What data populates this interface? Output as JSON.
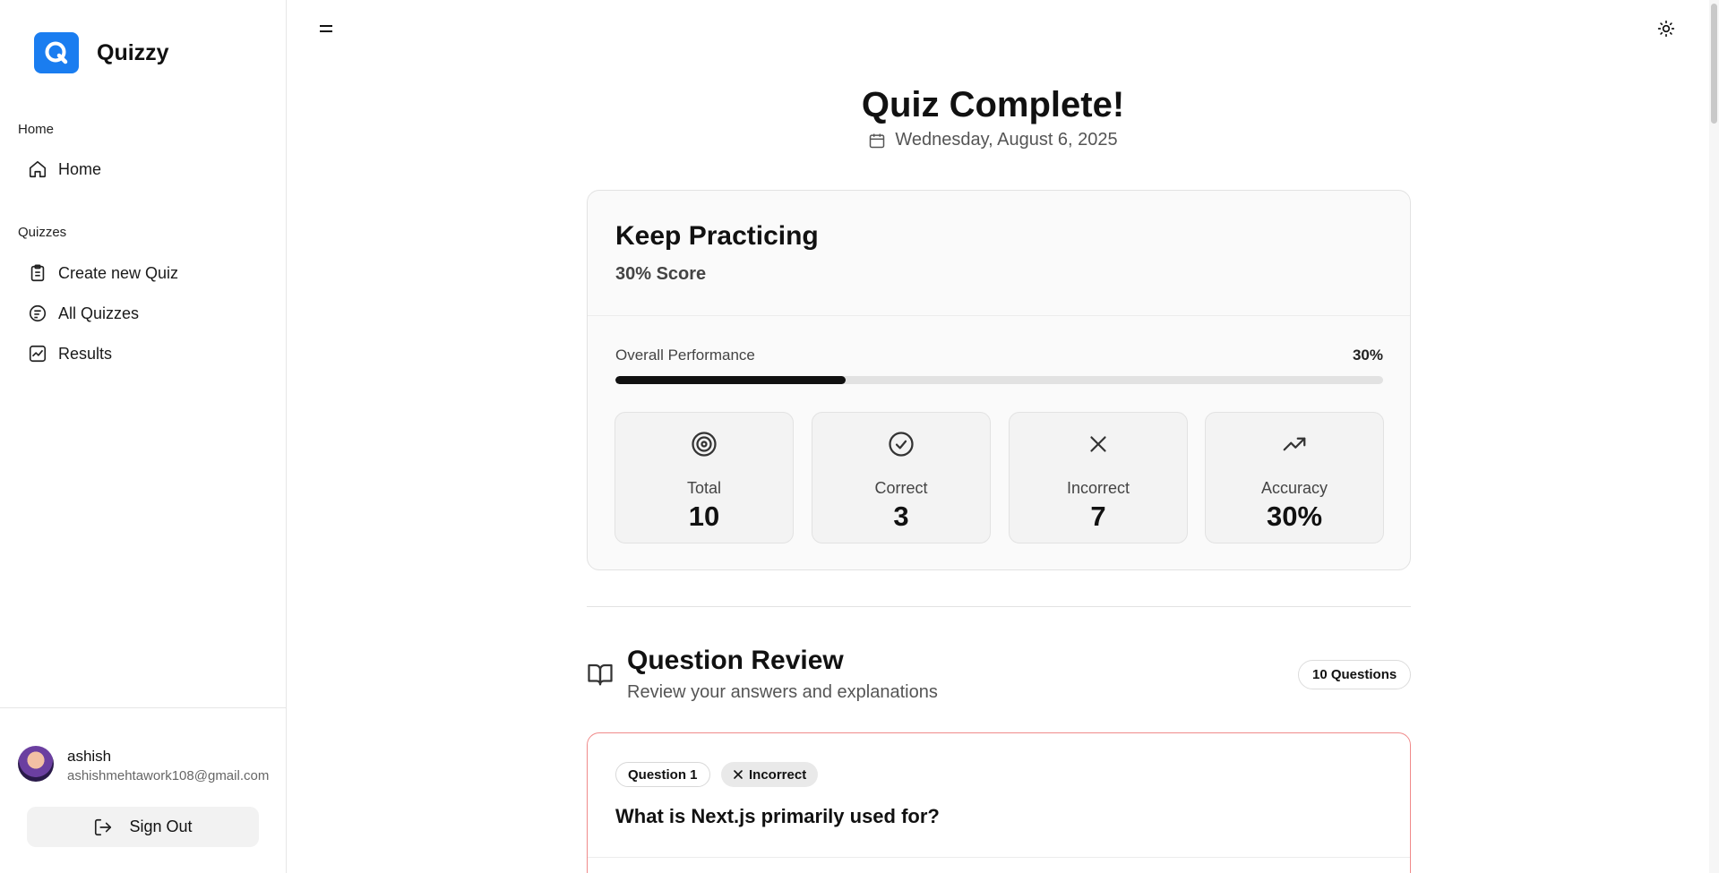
{
  "app": {
    "name": "Quizzy"
  },
  "sidebar": {
    "sections": [
      {
        "label": "Home",
        "items": [
          {
            "label": "Home",
            "icon": "home-icon"
          }
        ]
      },
      {
        "label": "Quizzes",
        "items": [
          {
            "label": "Create new Quiz",
            "icon": "clipboard-icon"
          },
          {
            "label": "All Quizzes",
            "icon": "quizzes-icon"
          },
          {
            "label": "Results",
            "icon": "results-icon"
          }
        ]
      }
    ],
    "user": {
      "name": "ashish",
      "email": "ashishmehtawork108@gmail.com"
    },
    "signout_label": "Sign Out"
  },
  "header": {
    "title": "Quiz Complete!",
    "date": "Wednesday, August 6, 2025"
  },
  "result": {
    "title": "Keep Practicing",
    "score_text": "30% Score",
    "performance_label": "Overall Performance",
    "performance_value": "30%",
    "performance_fraction": 0.3,
    "stats": [
      {
        "label": "Total",
        "value": "10",
        "icon": "target-icon"
      },
      {
        "label": "Correct",
        "value": "3",
        "icon": "check-circle-icon"
      },
      {
        "label": "Incorrect",
        "value": "7",
        "icon": "x-icon"
      },
      {
        "label": "Accuracy",
        "value": "30%",
        "icon": "trending-up-icon"
      }
    ]
  },
  "review": {
    "title": "Question Review",
    "subtitle": "Review your answers and explanations",
    "count_badge": "10 Questions",
    "questions": [
      {
        "number_label": "Question 1",
        "status": "Incorrect",
        "text": "What is Next.js primarily used for?"
      }
    ]
  },
  "colors": {
    "brand": "#1a7df0",
    "incorrect_border": "#f08a8a",
    "progress": "#111111"
  }
}
